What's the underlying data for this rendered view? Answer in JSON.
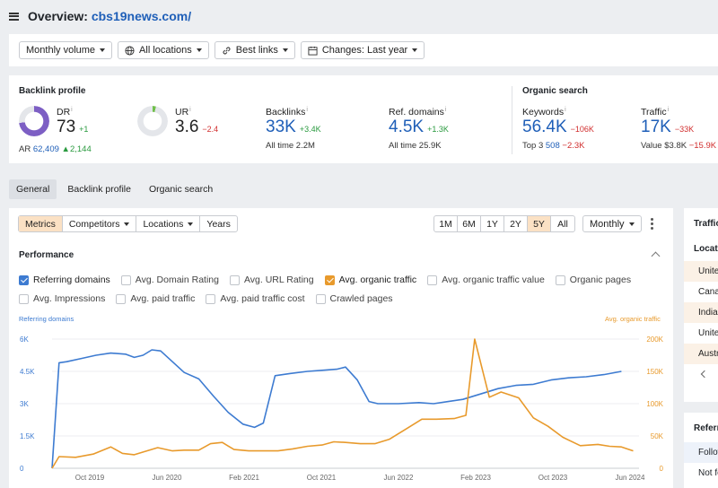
{
  "header": {
    "title_prefix": "Overview: ",
    "domain": "cbs19news.com/"
  },
  "filters": {
    "volume": "Monthly volume",
    "locations": "All locations",
    "links": "Best links",
    "changes": "Changes: Last year"
  },
  "backlink_profile": {
    "heading": "Backlink profile",
    "dr": {
      "label": "DR",
      "value": "73",
      "delta": "+1",
      "ar_label": "AR",
      "ar_value": "62,409",
      "ar_delta": "2,144",
      "fill_fraction": 0.73
    },
    "ur": {
      "label": "UR",
      "value": "3.6",
      "delta": "−2.4",
      "fill_fraction": 0.036
    },
    "backlinks": {
      "label": "Backlinks",
      "value": "33K",
      "delta": "+3.4K",
      "alltime_label": "All time",
      "alltime_value": "2.2M"
    },
    "ref_domains": {
      "label": "Ref. domains",
      "value": "4.5K",
      "delta": "+1.3K",
      "alltime_label": "All time",
      "alltime_value": "25.9K"
    }
  },
  "organic_search": {
    "heading": "Organic search",
    "keywords": {
      "label": "Keywords",
      "value": "56.4K",
      "delta": "−106K",
      "top_label": "Top 3",
      "top_value": "508",
      "top_delta": "−2.3K"
    },
    "traffic": {
      "label": "Traffic",
      "value": "17K",
      "delta": "−33K",
      "value_label": "Value",
      "value_amount": "$3.8K",
      "value_delta": "−15.9K"
    }
  },
  "tabs": [
    "General",
    "Backlink profile",
    "Organic search"
  ],
  "metric_tabs": [
    "Metrics",
    "Competitors",
    "Locations",
    "Years"
  ],
  "range_tabs": [
    "1M",
    "6M",
    "1Y",
    "2Y",
    "5Y",
    "All"
  ],
  "granularity": "Monthly",
  "performance": {
    "heading": "Performance",
    "checkboxes_row1": [
      {
        "label": "Referring domains",
        "checked": true,
        "color": "#3d7bd1"
      },
      {
        "label": "Avg. Domain Rating",
        "checked": false
      },
      {
        "label": "Avg. URL Rating",
        "checked": false
      },
      {
        "label": "Avg. organic traffic",
        "checked": true,
        "color": "#e89a2c"
      },
      {
        "label": "Avg. organic traffic value",
        "checked": false
      },
      {
        "label": "Organic pages",
        "checked": false
      }
    ],
    "checkboxes_row2": [
      {
        "label": "Avg. Impressions",
        "checked": false
      },
      {
        "label": "Avg. paid traffic",
        "checked": false
      },
      {
        "label": "Avg. paid traffic cost",
        "checked": false
      },
      {
        "label": "Crawled pages",
        "checked": false
      }
    ]
  },
  "chart_data": {
    "type": "line",
    "left_axis_title": "Referring domains",
    "right_axis_title": "Avg. organic traffic",
    "left_ticks": [
      "0",
      "1.5K",
      "3K",
      "4.5K",
      "6K"
    ],
    "right_ticks": [
      "0",
      "50K",
      "100K",
      "150K",
      "200K"
    ],
    "ylim_left": [
      0,
      6000
    ],
    "ylim_right": [
      0,
      200000
    ],
    "x_ticks": [
      "Oct 2019",
      "Jun 2020",
      "Feb 2021",
      "Oct 2021",
      "Jun 2022",
      "Feb 2023",
      "Oct 2023",
      "Jun 2024"
    ],
    "grid": true,
    "series": [
      {
        "name": "Referring domains",
        "color": "#3d7bd1",
        "axis": "left",
        "points": [
          [
            2019.5,
            0
          ],
          [
            2019.62,
            4900
          ],
          [
            2019.75,
            4950
          ],
          [
            2020.0,
            5100
          ],
          [
            2020.25,
            5250
          ],
          [
            2020.5,
            5350
          ],
          [
            2020.75,
            5300
          ],
          [
            2020.9,
            5150
          ],
          [
            2021.05,
            5250
          ],
          [
            2021.2,
            5500
          ],
          [
            2021.35,
            5450
          ],
          [
            2021.55,
            4950
          ],
          [
            2021.75,
            4450
          ],
          [
            2022.0,
            4150
          ],
          [
            2022.25,
            3350
          ],
          [
            2022.5,
            2600
          ],
          [
            2022.75,
            2050
          ],
          [
            2022.95,
            1900
          ],
          [
            2023.1,
            2100
          ],
          [
            2023.3,
            4300
          ],
          [
            2023.55,
            4400
          ],
          [
            2023.85,
            4500
          ],
          [
            2024.1,
            4550
          ],
          [
            2024.35,
            4600
          ],
          [
            2024.5,
            4700
          ],
          [
            2024.7,
            4100
          ],
          [
            2024.9,
            3100
          ],
          [
            2025.05,
            3000
          ],
          [
            2025.4,
            3000
          ],
          [
            2025.75,
            3050
          ],
          [
            2026.0,
            3000
          ],
          [
            2026.25,
            3100
          ],
          [
            2026.5,
            3200
          ],
          [
            2026.8,
            3450
          ],
          [
            2027.1,
            3700
          ],
          [
            2027.4,
            3850
          ],
          [
            2027.7,
            3900
          ],
          [
            2028.0,
            4100
          ],
          [
            2028.3,
            4200
          ],
          [
            2028.6,
            4250
          ],
          [
            2028.9,
            4350
          ],
          [
            2029.2,
            4500
          ]
        ]
      },
      {
        "name": "Avg. organic traffic",
        "color": "#e89a2c",
        "axis": "right",
        "points": [
          [
            2019.5,
            0
          ],
          [
            2019.62,
            18000
          ],
          [
            2019.9,
            17000
          ],
          [
            2020.2,
            22000
          ],
          [
            2020.5,
            33000
          ],
          [
            2020.7,
            23000
          ],
          [
            2020.9,
            21000
          ],
          [
            2021.3,
            32000
          ],
          [
            2021.55,
            27000
          ],
          [
            2021.75,
            28000
          ],
          [
            2022.0,
            28000
          ],
          [
            2022.2,
            38000
          ],
          [
            2022.4,
            40000
          ],
          [
            2022.6,
            29000
          ],
          [
            2022.85,
            27000
          ],
          [
            2023.1,
            27000
          ],
          [
            2023.35,
            27000
          ],
          [
            2023.6,
            30000
          ],
          [
            2023.85,
            34000
          ],
          [
            2024.1,
            36000
          ],
          [
            2024.3,
            41000
          ],
          [
            2024.5,
            40000
          ],
          [
            2024.75,
            38000
          ],
          [
            2025.0,
            38000
          ],
          [
            2025.25,
            45000
          ],
          [
            2025.55,
            62000
          ],
          [
            2025.8,
            76000
          ],
          [
            2026.05,
            76000
          ],
          [
            2026.35,
            77000
          ],
          [
            2026.55,
            82000
          ],
          [
            2026.7,
            200000
          ],
          [
            2026.95,
            110000
          ],
          [
            2027.15,
            118000
          ],
          [
            2027.45,
            109000
          ],
          [
            2027.7,
            78000
          ],
          [
            2027.95,
            65000
          ],
          [
            2028.2,
            48000
          ],
          [
            2028.5,
            35000
          ],
          [
            2028.8,
            37000
          ],
          [
            2029.0,
            34000
          ],
          [
            2029.2,
            33000
          ],
          [
            2029.4,
            27000
          ]
        ]
      }
    ]
  },
  "side_panels": {
    "traffic_heading": "Traffic",
    "locations_heading": "Locations",
    "locations": [
      "United States",
      "Canada",
      "India",
      "United Kingdom",
      "Australia"
    ],
    "referring_heading": "Referring",
    "referring_rows": [
      "Follow",
      "Not follow"
    ]
  }
}
